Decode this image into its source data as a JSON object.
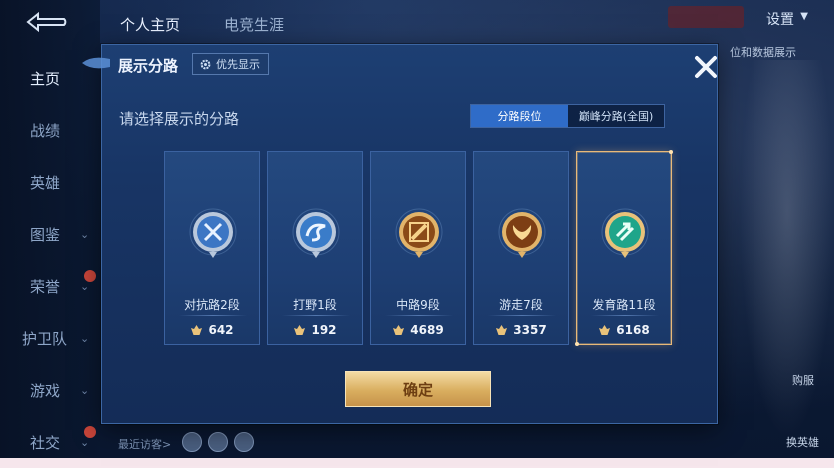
{
  "background": {
    "top_tabs": [
      "个人主页",
      "电竞生涯"
    ],
    "settings_label": "设置",
    "nav": [
      {
        "label": "主页",
        "chevron": false,
        "new": false,
        "active": true
      },
      {
        "label": "战绩",
        "chevron": false,
        "new": false,
        "active": false
      },
      {
        "label": "英雄",
        "chevron": false,
        "new": false,
        "active": false
      },
      {
        "label": "图鉴",
        "chevron": true,
        "new": false,
        "active": false
      },
      {
        "label": "荣誉",
        "chevron": true,
        "new": true,
        "active": false
      },
      {
        "label": "护卫队",
        "chevron": true,
        "new": false,
        "active": false
      },
      {
        "label": "游戏",
        "chevron": true,
        "new": false,
        "active": false
      },
      {
        "label": "社交",
        "chevron": true,
        "new": true,
        "active": false
      }
    ],
    "right_hint": "位和数据展示",
    "bottom_visitors_label": "最近访客>",
    "right_labels": [
      "购服",
      "换英雄"
    ]
  },
  "modal": {
    "title": "展示分路",
    "priority_label": "优先显示",
    "prompt": "请选择展示的分路",
    "toggle": {
      "options": [
        "分路段位",
        "巅峰分路(全国)"
      ],
      "active": 0
    },
    "confirm_label": "确定",
    "lanes": [
      {
        "name": "对抗路2段",
        "score": "642",
        "icon": "silver-crossed-swords-emblem",
        "selected": false
      },
      {
        "name": "打野1段",
        "score": "192",
        "icon": "silver-swirl-emblem",
        "selected": false
      },
      {
        "name": "中路9段",
        "score": "4689",
        "icon": "gold-wand-emblem",
        "selected": false
      },
      {
        "name": "游走7段",
        "score": "3357",
        "icon": "gold-wing-emblem",
        "selected": false
      },
      {
        "name": "发育路11段",
        "score": "6168",
        "icon": "jade-arrow-emblem",
        "selected": true
      }
    ]
  },
  "colors": {
    "modal_bg": "#183565",
    "toggle_active": "#2f6cc8",
    "selected_border": "#e9b978",
    "confirm_gold": "#d9ae5f"
  }
}
